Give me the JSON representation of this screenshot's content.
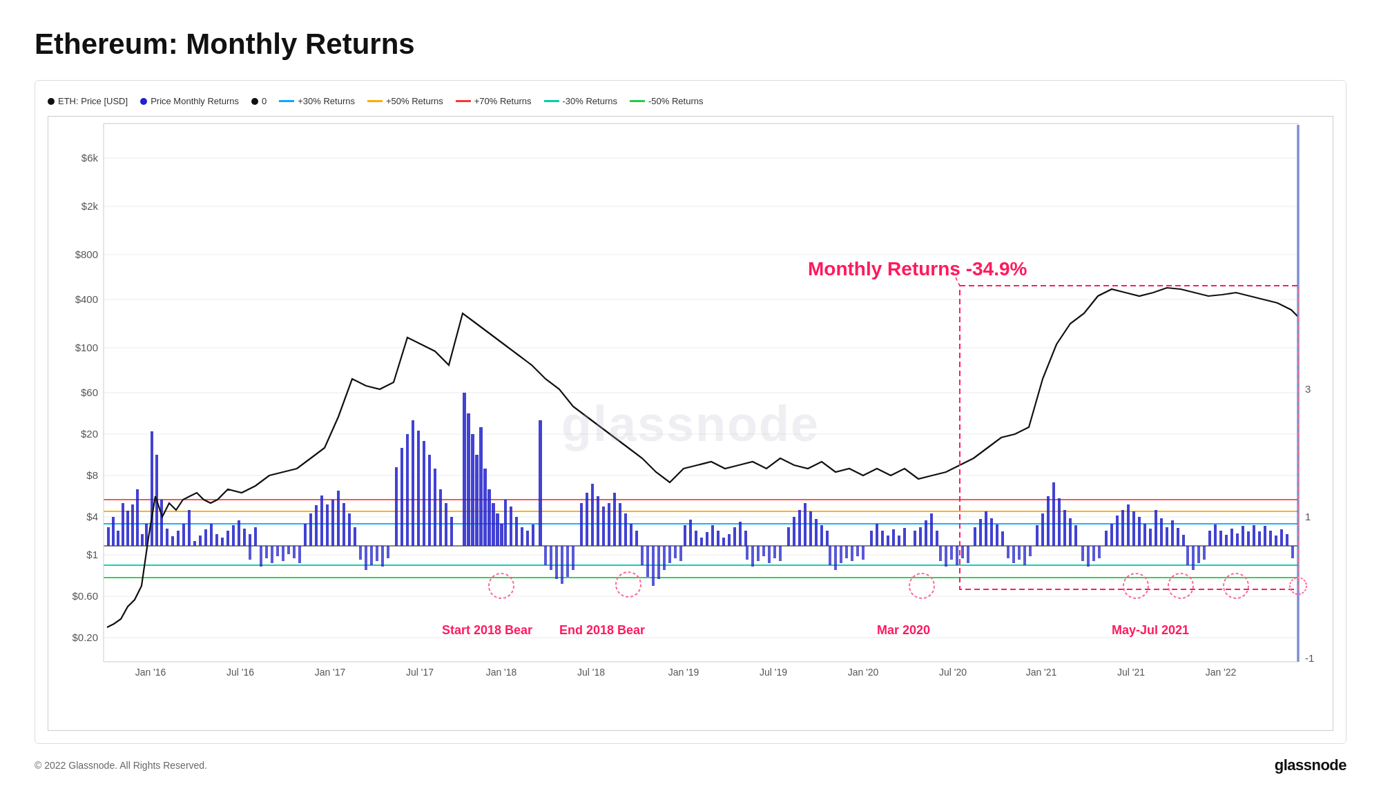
{
  "page": {
    "title": "Ethereum: Monthly Returns",
    "footer_copyright": "© 2022 Glassnode. All Rights Reserved.",
    "footer_logo": "glassnode"
  },
  "legend": {
    "items": [
      {
        "id": "eth-price",
        "label": "ETH: Price [USD]",
        "color": "#111111",
        "type": "dot"
      },
      {
        "id": "price-monthly-returns",
        "label": "Price Monthly Returns",
        "color": "#2222cc",
        "type": "dot"
      },
      {
        "id": "zero",
        "label": "0",
        "color": "#111111",
        "type": "dot"
      },
      {
        "id": "plus30",
        "label": "+30% Returns",
        "color": "#00aaff",
        "type": "line"
      },
      {
        "id": "plus50",
        "label": "+50% Returns",
        "color": "#ffaa00",
        "type": "line"
      },
      {
        "id": "plus70",
        "label": "+70% Returns",
        "color": "#ff3333",
        "type": "line"
      },
      {
        "id": "minus30",
        "label": "-30% Returns",
        "color": "#00ccaa",
        "type": "line"
      },
      {
        "id": "minus50",
        "label": "-50% Returns",
        "color": "#22cc44",
        "type": "line"
      }
    ]
  },
  "chart": {
    "annotation_label": "Monthly Returns -34.9%",
    "annotation_color": "#ff1a5e",
    "watermark": "glassnode",
    "y_axis_left": [
      "$6k",
      "$2k",
      "$800",
      "$400",
      "$100",
      "$60",
      "$20",
      "$8",
      "$4",
      "$1",
      "$0.60",
      "$0.20"
    ],
    "y_axis_right": [
      "3",
      "1",
      "-1"
    ],
    "x_axis": [
      "Jan '16",
      "Jul '16",
      "Jan '17",
      "Jul '17",
      "Jan '18",
      "Jul '18",
      "Jan '19",
      "Jul '19",
      "Jan '20",
      "Jul '20",
      "Jan '21",
      "Jul '21",
      "Jan '22"
    ],
    "annotations": [
      {
        "id": "start-2018-bear",
        "label": "Start 2018 Bear",
        "color": "#ff1a5e"
      },
      {
        "id": "end-2018-bear",
        "label": "End 2018 Bear",
        "color": "#ff1a5e"
      },
      {
        "id": "mar-2020",
        "label": "Mar 2020",
        "color": "#ff1a5e"
      },
      {
        "id": "may-jul-2021",
        "label": "May-Jul 2021",
        "color": "#ff1a5e"
      }
    ]
  }
}
